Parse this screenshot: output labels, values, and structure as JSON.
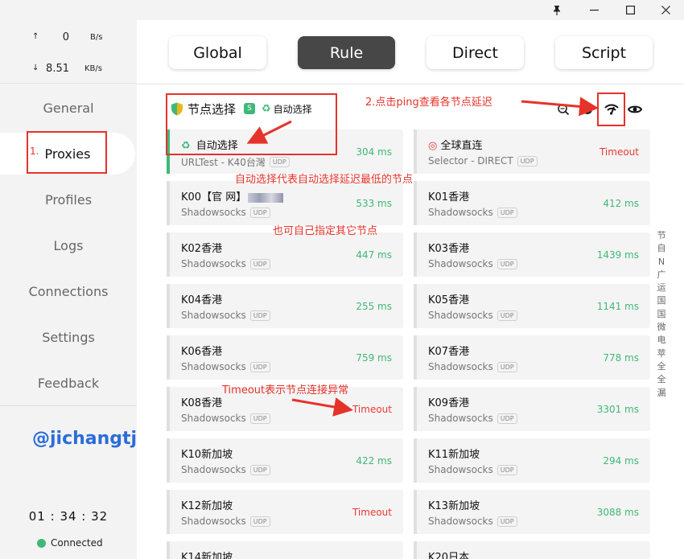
{
  "titlebar": {
    "pin_icon": "pin-icon",
    "min_icon": "minimize-icon",
    "max_icon": "maximize-icon",
    "close_icon": "close-icon"
  },
  "traffic": {
    "up": {
      "arrow": "↑",
      "value": "0",
      "unit": "B/s"
    },
    "down": {
      "arrow": "↓",
      "value": "8.51",
      "unit": "KB/s"
    }
  },
  "nav": {
    "items": [
      {
        "label": "General",
        "active": false
      },
      {
        "label": "Proxies",
        "active": true,
        "index_label": "1."
      },
      {
        "label": "Profiles",
        "active": false
      },
      {
        "label": "Logs",
        "active": false
      },
      {
        "label": "Connections",
        "active": false
      },
      {
        "label": "Settings",
        "active": false
      },
      {
        "label": "Feedback",
        "active": false
      }
    ]
  },
  "runtime": {
    "time": "01 : 34 : 32",
    "status": "Connected",
    "status_color": "#3fb877"
  },
  "modes": {
    "global": "Global",
    "rule": "Rule",
    "direct": "Direct",
    "script": "Script",
    "active": "Rule"
  },
  "group": {
    "name": "节点选择",
    "badge": "S",
    "selected": "自动选择"
  },
  "proxies": {
    "left": [
      {
        "name": "自动选择",
        "type": "URLTest - K40台灣",
        "udp": "UDP",
        "delay": "304 ms"
      },
      {
        "name": "K00【官 网】",
        "type": "Shadowsocks",
        "udp": "UDP",
        "delay": "533 ms"
      },
      {
        "name": "K02香港",
        "type": "Shadowsocks",
        "udp": "UDP",
        "delay": "447 ms"
      },
      {
        "name": "K04香港",
        "type": "Shadowsocks",
        "udp": "UDP",
        "delay": "255 ms"
      },
      {
        "name": "K06香港",
        "type": "Shadowsocks",
        "udp": "UDP",
        "delay": "759 ms"
      },
      {
        "name": "K08香港",
        "type": "Shadowsocks",
        "udp": "UDP",
        "delay": "Timeout"
      },
      {
        "name": "K10新加坡",
        "type": "Shadowsocks",
        "udp": "UDP",
        "delay": "422 ms"
      },
      {
        "name": "K12新加坡",
        "type": "Shadowsocks",
        "udp": "UDP",
        "delay": "Timeout"
      },
      {
        "name": "K14新加坡",
        "type": "",
        "udp": "",
        "delay": ""
      }
    ],
    "right": [
      {
        "name": "全球直连",
        "type": "Selector - DIRECT",
        "udp": "UDP",
        "delay": "Timeout"
      },
      {
        "name": "K01香港",
        "type": "Shadowsocks",
        "udp": "UDP",
        "delay": "412 ms"
      },
      {
        "name": "K03香港",
        "type": "Shadowsocks",
        "udp": "UDP",
        "delay": "1439 ms"
      },
      {
        "name": "K05香港",
        "type": "Shadowsocks",
        "udp": "UDP",
        "delay": "1141 ms"
      },
      {
        "name": "K07香港",
        "type": "Shadowsocks",
        "udp": "UDP",
        "delay": "778 ms"
      },
      {
        "name": "K09香港",
        "type": "Shadowsocks",
        "udp": "UDP",
        "delay": "3301 ms"
      },
      {
        "name": "K11新加坡",
        "type": "Shadowsocks",
        "udp": "UDP",
        "delay": "294 ms"
      },
      {
        "name": "K13新加坡",
        "type": "Shadowsocks",
        "udp": "UDP",
        "delay": "3088 ms"
      },
      {
        "name": "K20日本",
        "type": "",
        "udp": "",
        "delay": ""
      }
    ]
  },
  "scroll_index": [
    "节",
    "自",
    "N",
    "广",
    "运",
    "国",
    "国",
    "微",
    "电",
    "苹",
    "全",
    "全",
    "漏"
  ],
  "annotations": {
    "ping_hint": "2.点击ping查看各节点延迟",
    "auto_hint": "自动选择代表自动选择延迟最低的节点",
    "manual_hint": "也可自己指定其它节点",
    "timeout_hint": "Timeout表示节点连接异常",
    "watermark": "@jichangtj"
  },
  "colors": {
    "accent_green": "#3fb877",
    "annotation_red": "#e5332a",
    "watermark_blue": "#2a6dd9",
    "active_mode": "#474747"
  }
}
